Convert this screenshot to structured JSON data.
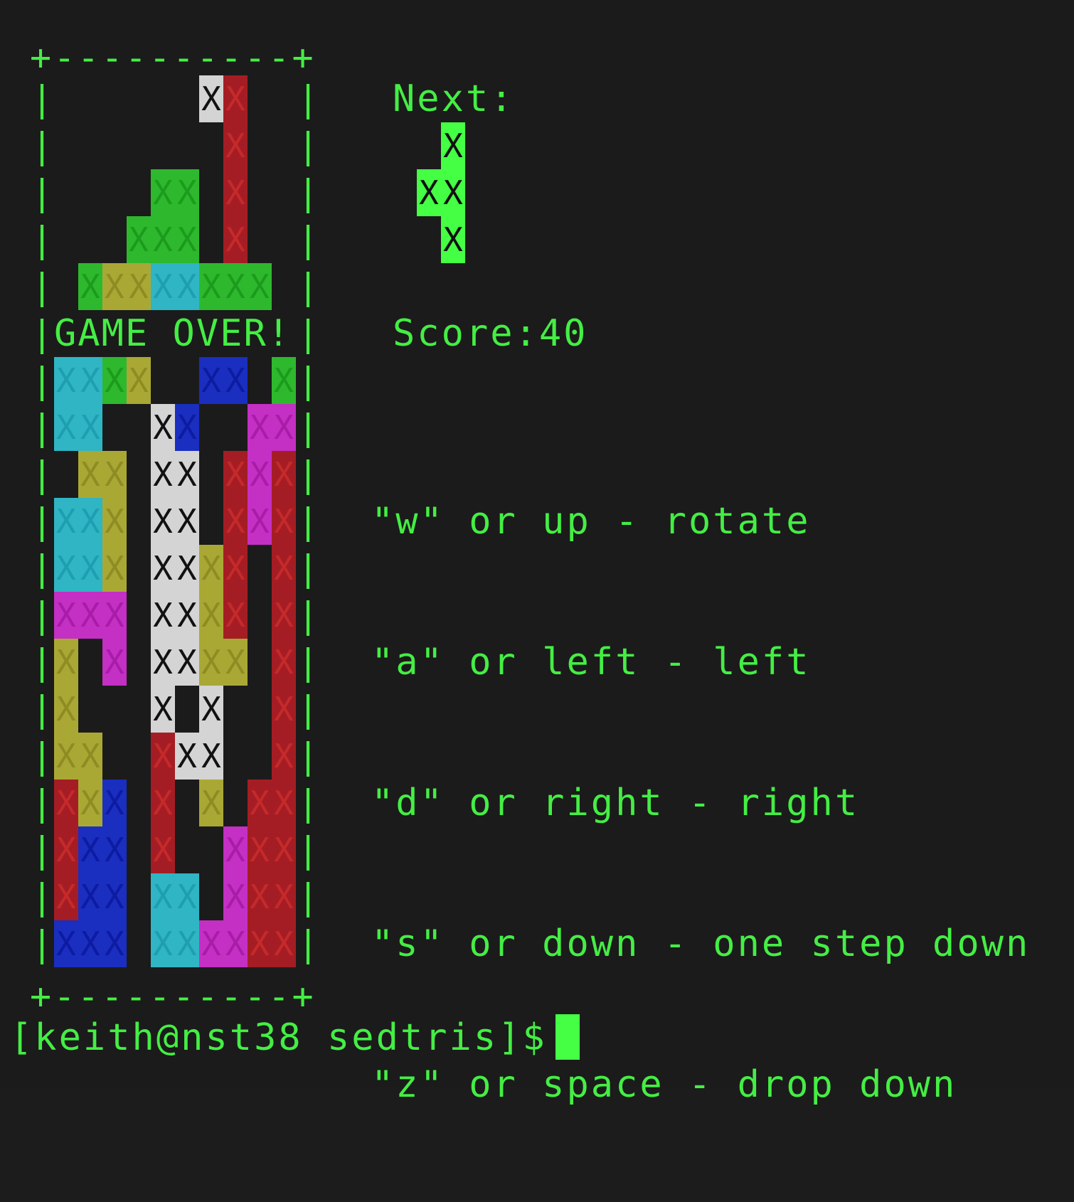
{
  "terminal": {
    "border_top": "+----------+",
    "border_bottom": "+----------+",
    "side_char": "|",
    "game_over": "GAME OVER!",
    "next_label": "Next:",
    "score_label": "Score:",
    "score_value": "40",
    "controls": [
      "\"w\" or up - rotate",
      "\"a\" or left - left",
      "\"d\" or right - right",
      "\"s\" or down - one step down",
      "\"z\" or space - drop down"
    ],
    "prompt": "[keith@nst38 sedtris]$",
    "cell_char": "X"
  },
  "colors": {
    "green_text": "#44ee44",
    "W": {
      "bg": "#d4d4d4",
      "fg": "#111111"
    },
    "R": {
      "bg": "#a51d24",
      "fg": "#c52a2a"
    },
    "G": {
      "bg": "#2eb82e",
      "fg": "#1c9b1c"
    },
    "Y": {
      "bg": "#aaa835",
      "fg": "#8e8c22"
    },
    "C": {
      "bg": "#2fb5c4",
      "fg": "#1e9eb0"
    },
    "B": {
      "bg": "#1a2ec0",
      "fg": "#0c1ba0"
    },
    "M": {
      "bg": "#c42fc4",
      "fg": "#a81ca8"
    },
    "N": {
      "bg": "#44ff44",
      "fg": "#111111"
    }
  },
  "board_rows": [
    "......WR..",
    ".......R..",
    "....GG.R..",
    "...GGG.R..",
    ".GYYCCGGG.",
    "..........",
    "CCGY..BB.G",
    "CC..WB..MM",
    ".YY.WW.RMR",
    "CCY.WW.RMR",
    "CCY.WWYR.R",
    "MMM.WWYR.R",
    "Y.M.WWYY.R",
    "Y...W.W..R",
    "YY..RWW..R",
    "RYB.R.Y.RR",
    "RBB.R..MRR",
    "RBB.CC.MRR",
    "BBB.CCMMRR"
  ],
  "next_rows": [
    ".N",
    "NN",
    ".N"
  ]
}
